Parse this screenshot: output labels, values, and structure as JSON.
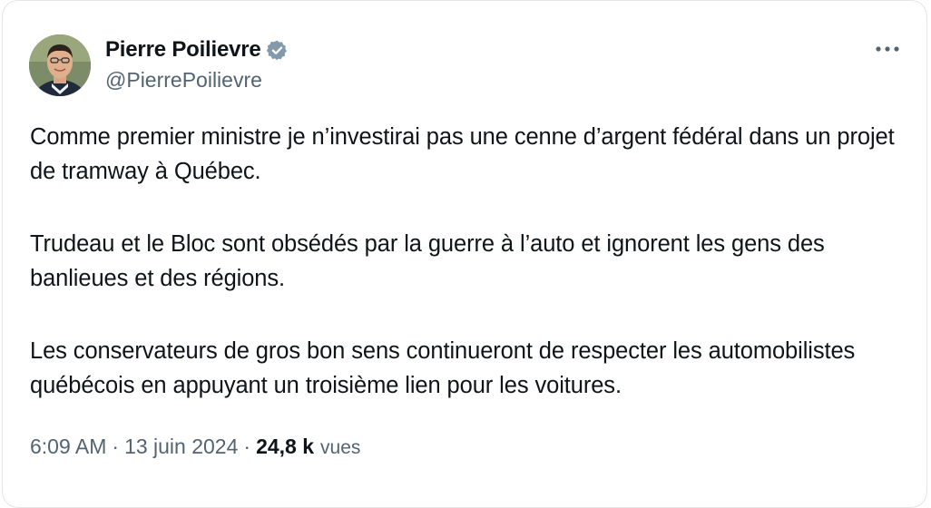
{
  "author": {
    "display_name": "Pierre Poilievre",
    "handle": "@PierrePoilievre",
    "verified_icon": "verified-badge-icon",
    "avatar": "profile-photo"
  },
  "menu": {
    "icon": "more-horizontal-icon"
  },
  "tweet": {
    "paragraphs": [
      "Comme premier ministre je n’investirai pas une cenne d’argent fédéral dans un projet de tramway à Québec.",
      "Trudeau et le Bloc sont obsédés par la guerre à l’auto et ignorent les gens des banlieues et des régions.",
      "Les conservateurs de gros bon sens continueront de respecter les automobilistes québécois en appuyant un troisième lien pour les voitures."
    ]
  },
  "meta": {
    "time": "6:09 AM",
    "separator": "·",
    "date": "13 juin 2024",
    "views_count": "24,8 k",
    "views_label": "vues"
  },
  "colors": {
    "text_primary": "#0f1419",
    "text_secondary": "#536471",
    "verified_badge": "#829aab",
    "border": "#e3e6e9"
  }
}
